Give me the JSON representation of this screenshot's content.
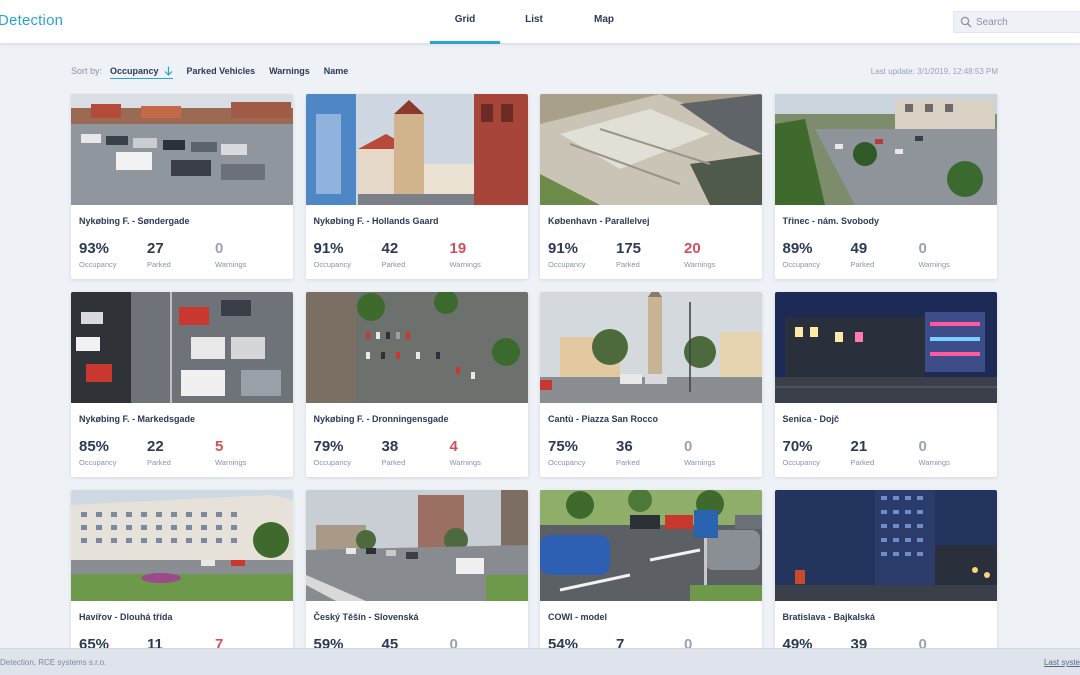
{
  "header": {
    "brand": "Detection",
    "tabs": [
      {
        "label": "Grid",
        "active": true
      },
      {
        "label": "List",
        "active": false
      },
      {
        "label": "Map",
        "active": false
      }
    ],
    "search_placeholder": "Search"
  },
  "sort": {
    "label": "Sort by:",
    "options": [
      "Occupancy",
      "Parked Vehicles",
      "Warnings",
      "Name"
    ],
    "active": "Occupancy",
    "direction_icon": "arrow-down-icon"
  },
  "last_update": "Last update: 3/1/2019, 12:48:53 PM",
  "stat_labels": {
    "occupancy": "Occupancy",
    "parked": "Parked",
    "warnings": "Warnings"
  },
  "cards": [
    {
      "title": "Nykøbing F. - Søndergade",
      "occupancy": "93%",
      "parked": "27",
      "warnings": "0"
    },
    {
      "title": "Nykøbing F. - Hollands Gaard",
      "occupancy": "91%",
      "parked": "42",
      "warnings": "19"
    },
    {
      "title": "København - Parallelvej",
      "occupancy": "91%",
      "parked": "175",
      "warnings": "20"
    },
    {
      "title": "Třinec - nám. Svobody",
      "occupancy": "89%",
      "parked": "49",
      "warnings": "0"
    },
    {
      "title": "Nykøbing F. - Markedsgade",
      "occupancy": "85%",
      "parked": "22",
      "warnings": "5"
    },
    {
      "title": "Nykøbing F. - Dronningensgade",
      "occupancy": "79%",
      "parked": "38",
      "warnings": "4"
    },
    {
      "title": "Cantù - Piazza San Rocco",
      "occupancy": "75%",
      "parked": "36",
      "warnings": "0"
    },
    {
      "title": "Senica - Dojč",
      "occupancy": "70%",
      "parked": "21",
      "warnings": "0"
    },
    {
      "title": "Havířov - Dlouhá třída",
      "occupancy": "65%",
      "parked": "11",
      "warnings": "7"
    },
    {
      "title": "Český Těšín - Slovenská",
      "occupancy": "59%",
      "parked": "45",
      "warnings": "0"
    },
    {
      "title": "COWI - model",
      "occupancy": "54%",
      "parked": "7",
      "warnings": "0"
    },
    {
      "title": "Bratislava - Bajkalská",
      "occupancy": "49%",
      "parked": "39",
      "warnings": "0"
    }
  ],
  "footer": {
    "left": "Detection, RCE systems s.r.o.",
    "right": "Last syste"
  },
  "colors": {
    "accent": "#2aa3d6",
    "text": "#2b3a55",
    "warning": "#d1505c",
    "muted": "#9aa3b3"
  }
}
